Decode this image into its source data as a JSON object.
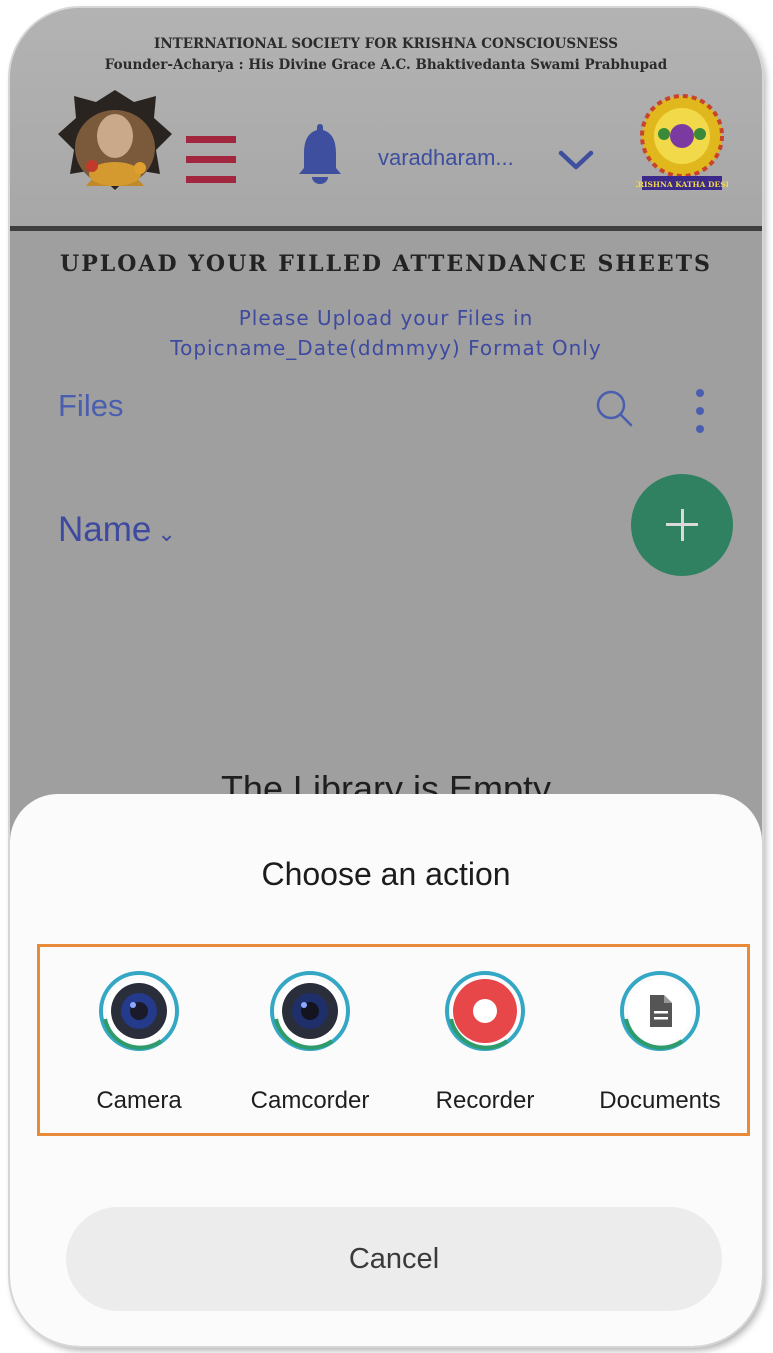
{
  "header": {
    "org_name": "INTERNATIONAL SOCIETY FOR KRISHNA CONSCIOUSNESS",
    "founder_line": "Founder-Acharya : His Divine Grace A.C. Bhaktivedanta Swami Prabhupad",
    "user_name": "varadharam...",
    "right_logo_text": "KRISHNA KATHA DESH",
    "hamburger_color": "#a3263f",
    "bell_color": "#3d4f9e",
    "icons": [
      "founder-logo",
      "menu-icon",
      "bell-icon",
      "chevron-down-icon",
      "organization-logo"
    ]
  },
  "page": {
    "heading": "UPLOAD YOUR FILLED ATTENDANCE SHEETS",
    "note_line1": "Please Upload your Files in",
    "note_line2": "Topicname_Date(ddmmyy) Format Only",
    "files_label": "Files",
    "sort_label": "Name",
    "empty_message": "The Library is Empty",
    "fab_color": "#2f8161",
    "icons": [
      "search-icon",
      "more-vertical-icon",
      "plus-icon"
    ]
  },
  "sheet": {
    "title": "Choose an action",
    "actions": [
      {
        "label": "Camera",
        "icon": "camera-icon"
      },
      {
        "label": "Camcorder",
        "icon": "camcorder-icon"
      },
      {
        "label": "Recorder",
        "icon": "recorder-icon"
      },
      {
        "label": "Documents",
        "icon": "documents-icon"
      }
    ],
    "highlight_color": "#e98a3a",
    "cancel_label": "Cancel"
  }
}
